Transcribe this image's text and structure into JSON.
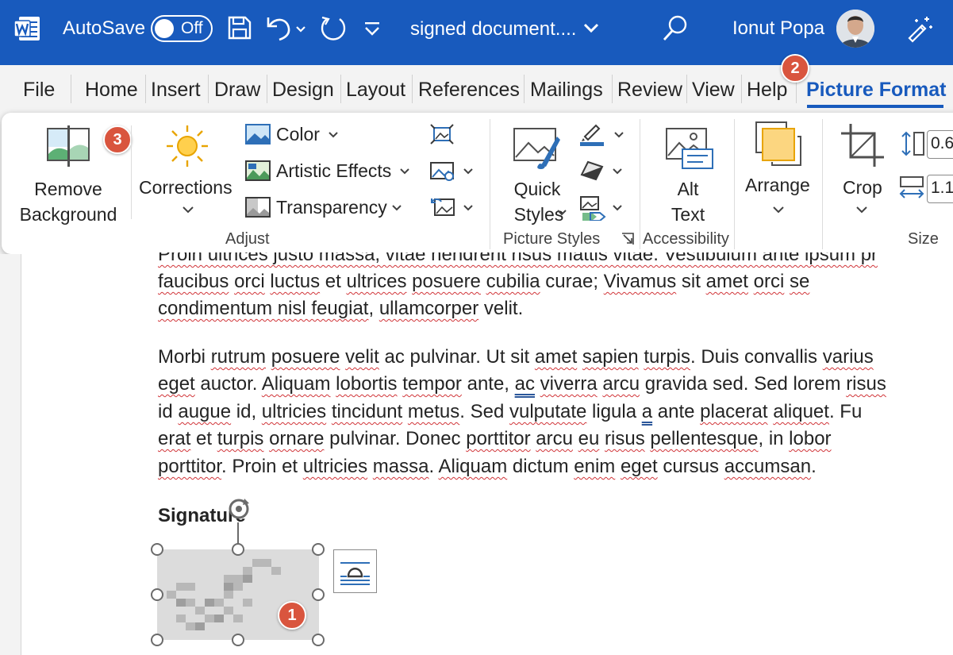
{
  "titlebar": {
    "autosave_label": "AutoSave",
    "autosave_state": "Off",
    "document_title": "signed document....",
    "user_name": "Ionut Popa"
  },
  "tabs": [
    {
      "label": "File"
    },
    {
      "label": "Home"
    },
    {
      "label": "Insert"
    },
    {
      "label": "Draw"
    },
    {
      "label": "Design"
    },
    {
      "label": "Layout"
    },
    {
      "label": "References"
    },
    {
      "label": "Mailings"
    },
    {
      "label": "Review"
    },
    {
      "label": "View"
    },
    {
      "label": "Help"
    },
    {
      "label": "Picture Format",
      "active": true
    }
  ],
  "ribbon": {
    "remove_background": [
      "Remove",
      "Background"
    ],
    "corrections": "Corrections",
    "color": "Color",
    "artistic_effects": "Artistic Effects",
    "transparency": "Transparency",
    "adjust_label": "Adjust",
    "quick_styles": [
      "Quick",
      "Styles"
    ],
    "picture_styles_label": "Picture Styles",
    "alt_text": [
      "Alt",
      "Text"
    ],
    "accessibility_label": "Accessibility",
    "arrange": "Arrange",
    "crop": "Crop",
    "height_value": "0.6",
    "width_value": "1.1",
    "size_label": "Size"
  },
  "badges": {
    "badge1": "1",
    "badge2": "2",
    "badge3": "3"
  },
  "document": {
    "para1_line1": "Proin ultrices justo massa, vitae hendrerit risus mattis vitae. Vestibulum ante ipsum pr",
    "para1_line2": [
      "faucibus",
      " ",
      "orci",
      " ",
      "luctus",
      " et ",
      "ultrices",
      " ",
      "posuere",
      " ",
      "cubilia",
      " curae; ",
      "Vivamus",
      " sit ",
      "amet",
      " ",
      "orci",
      " ",
      "se"
    ],
    "para1_line3": [
      "condimentum nisl feugiat",
      ", ",
      "ullamcorper",
      " velit."
    ],
    "para2_line1": [
      "Morbi ",
      "rutrum",
      " ",
      "posuere",
      " ",
      "velit",
      " ac pulvinar. Ut sit ",
      "amet",
      " ",
      "sapien",
      " ",
      "turpis",
      ". Duis convallis ",
      "varius"
    ],
    "para2_line2": [
      "eget",
      " auctor. ",
      "Aliquam",
      " ",
      "lobortis",
      " ",
      "tempor",
      " ante, ",
      "ac",
      " ",
      "viverra",
      " ",
      "arcu",
      " gravida sed. Sed lorem ",
      "risus"
    ],
    "para2_line3": [
      "id ",
      "augue",
      " id, ",
      "ultricies",
      " ",
      "tincidunt",
      " ",
      "metus",
      ". Sed ",
      "vulputate",
      " ligula ",
      "a",
      " ante ",
      "placerat",
      " ",
      "aliquet",
      ". Fu"
    ],
    "para2_line4": [
      "erat",
      " et ",
      "turpis",
      " ",
      "ornare",
      " pulvinar. Donec ",
      "porttitor",
      " ",
      "arcu",
      " ",
      "eu",
      " ",
      "risus",
      " ",
      "pellentesque",
      ", in ",
      "lobor"
    ],
    "para2_line5": [
      "porttitor",
      ". Proin et ",
      "ultricies",
      " ",
      "massa",
      ". ",
      "Aliquam",
      " dictum ",
      "enim",
      " ",
      "eget",
      " cursus ",
      "accumsan",
      "."
    ],
    "signature_heading": "Signature"
  },
  "colors": {
    "titlebar": "#185abd",
    "accent": "#185abd",
    "badge": "#d9553e"
  }
}
